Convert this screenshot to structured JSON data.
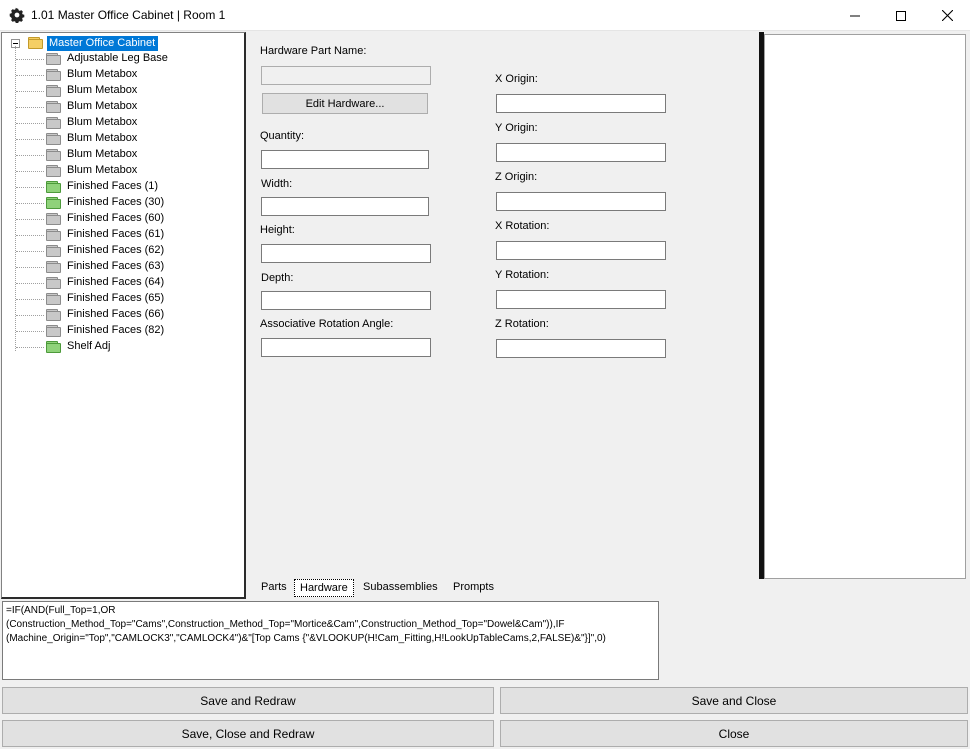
{
  "window": {
    "title": "1.01 Master Office Cabinet | Room 1",
    "icon": "gear-icon",
    "controls": {
      "minimize": "minimize-icon",
      "maximize": "maximize-icon",
      "close": "close-icon"
    }
  },
  "tree": {
    "root": {
      "label": "Master Office Cabinet",
      "icon": "folder-open-icon"
    },
    "items": [
      {
        "label": "Adjustable Leg Base",
        "color": "gray"
      },
      {
        "label": "Blum Metabox",
        "color": "gray"
      },
      {
        "label": "Blum Metabox",
        "color": "gray"
      },
      {
        "label": "Blum Metabox",
        "color": "gray"
      },
      {
        "label": "Blum Metabox",
        "color": "gray"
      },
      {
        "label": "Blum Metabox",
        "color": "gray"
      },
      {
        "label": "Blum Metabox",
        "color": "gray"
      },
      {
        "label": "Blum Metabox",
        "color": "gray"
      },
      {
        "label": "Finished Faces (1)",
        "color": "green"
      },
      {
        "label": "Finished Faces (30)",
        "color": "green"
      },
      {
        "label": "Finished Faces (60)",
        "color": "gray"
      },
      {
        "label": "Finished Faces (61)",
        "color": "gray"
      },
      {
        "label": "Finished Faces (62)",
        "color": "gray"
      },
      {
        "label": "Finished Faces (63)",
        "color": "gray"
      },
      {
        "label": "Finished Faces (64)",
        "color": "gray"
      },
      {
        "label": "Finished Faces (65)",
        "color": "gray"
      },
      {
        "label": "Finished Faces (66)",
        "color": "gray"
      },
      {
        "label": "Finished Faces (82)",
        "color": "gray"
      },
      {
        "label": "Shelf Adj",
        "color": "green"
      }
    ]
  },
  "hardware": {
    "part_name_label": "Hardware Part Name:",
    "part_name_value": "",
    "edit_button": "Edit Hardware...",
    "quantity_label": "Quantity:",
    "quantity_value": "",
    "width_label": "Width:",
    "width_value": "",
    "height_label": "Height:",
    "height_value": "",
    "depth_label": "Depth:",
    "depth_value": "",
    "assoc_rotation_label": "Associative Rotation Angle:",
    "assoc_rotation_value": "",
    "x_origin_label": "X Origin:",
    "x_origin_value": "",
    "y_origin_label": "Y Origin:",
    "y_origin_value": "",
    "z_origin_label": "Z Origin:",
    "z_origin_value": "",
    "x_rotation_label": "X Rotation:",
    "x_rotation_value": "",
    "y_rotation_label": "Y Rotation:",
    "y_rotation_value": "",
    "z_rotation_label": "Z Rotation:",
    "z_rotation_value": ""
  },
  "tabs": [
    {
      "label": "Parts",
      "active": false
    },
    {
      "label": "Hardware",
      "active": true
    },
    {
      "label": "Subassemblies",
      "active": false
    },
    {
      "label": "Prompts",
      "active": false
    }
  ],
  "formula": "=IF(AND(Full_Top=1,OR\n(Construction_Method_Top=\"Cams\",Construction_Method_Top=\"Mortice&Cam\",Construction_Method_Top=\"Dowel&Cam\")),IF\n(Machine_Origin=\"Top\",\"CAMLOCK3\",\"CAMLOCK4\")&\"[Top Cams {\"&VLOOKUP(H!Cam_Fitting,H!LookUpTableCams,2,FALSE)&\"}]\",0)",
  "buttons": {
    "save_redraw": "Save and Redraw",
    "save_close": "Save and Close",
    "save_close_redraw": "Save, Close and Redraw",
    "close": "Close"
  },
  "colors": {
    "selection": "#0078d7",
    "folder_gray": "#c8c8c8",
    "folder_green": "#8fd27a",
    "folder_open": "#f5cf64"
  }
}
